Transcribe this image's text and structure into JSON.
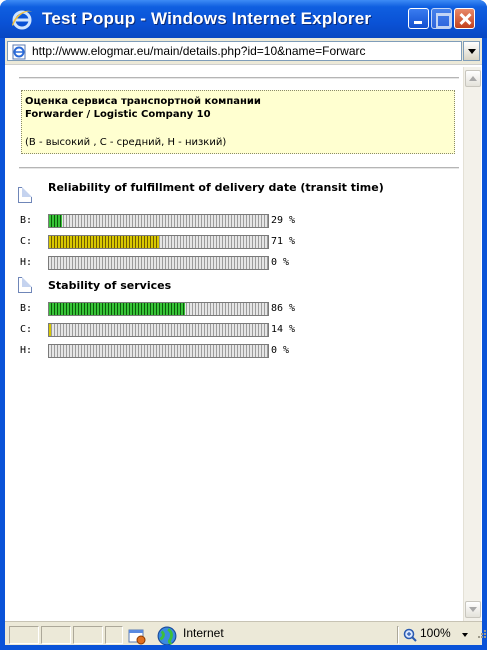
{
  "window": {
    "title": "Test Popup - Windows Internet Explorer"
  },
  "address": {
    "url": "http://www.elogmar.eu/main/details.php?id=10&name=Forwarc"
  },
  "info": {
    "title_line1": "Оценка сервиса транспортной компании",
    "title_line2": "Forwarder / Logistic Company 10",
    "legend": "(В - высокий , С - средний, Н - низкий)"
  },
  "sections": [
    {
      "title": "Reliability of fulfillment of delivery date (transit time)",
      "rows": [
        {
          "label": "В:",
          "percent_text": "29 %",
          "fraction": 0.06,
          "color": "green"
        },
        {
          "label": "С:",
          "percent_text": "71 %",
          "fraction": 0.5,
          "color": "yellow"
        },
        {
          "label": "Н:",
          "percent_text": "0 %",
          "fraction": 0,
          "color": "gray"
        }
      ]
    },
    {
      "title": "Stability of services",
      "rows": [
        {
          "label": "В:",
          "percent_text": "86 %",
          "fraction": 0.62,
          "color": "green"
        },
        {
          "label": "С:",
          "percent_text": "14 %",
          "fraction": 0.01,
          "color": "yellow"
        },
        {
          "label": "Н:",
          "percent_text": "0 %",
          "fraction": 0,
          "color": "gray"
        }
      ]
    }
  ],
  "status": {
    "zone": "Internet",
    "zoom": "100%"
  },
  "colors": {
    "titlebar": "#0a52d6",
    "info_background": "#ffffd0",
    "bar_green": "#38c438",
    "bar_yellow": "#d8c800"
  },
  "icons": [
    "ie-logo-icon",
    "minimize-icon",
    "maximize-icon",
    "close-icon",
    "page-icon",
    "document-icon",
    "protected-mode-icon",
    "globe-icon",
    "zoom-icon",
    "resize-grip-icon"
  ]
}
